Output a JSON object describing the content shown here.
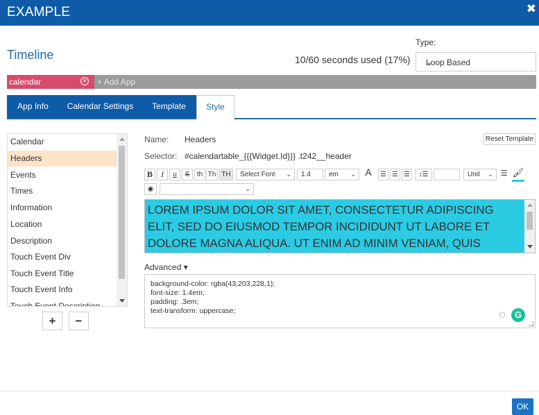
{
  "window": {
    "title": "EXAMPLE",
    "close_glyph": "✖"
  },
  "header": {
    "title": "Timeline",
    "usage": "10/60 seconds used (17%)"
  },
  "type": {
    "label": "Type:",
    "value": "Loop Based"
  },
  "apps": {
    "tag": "calendar",
    "add_placeholder": "+ Add App"
  },
  "tabs": [
    {
      "label": "App Info"
    },
    {
      "label": "Calendar Settings"
    },
    {
      "label": "Template"
    },
    {
      "label": "Style",
      "active": true
    }
  ],
  "style_list": {
    "items": [
      "Calendar",
      "Headers",
      "Events",
      "Times",
      "Information",
      "Location",
      "Description",
      "Touch Event Div",
      "Touch Event Title",
      "Touch Event Info",
      "Touch Event Description"
    ],
    "selected": "Headers",
    "add_label": "+",
    "remove_label": "−"
  },
  "editor": {
    "name_label": "Name:",
    "name_value": "Headers",
    "selector_label": "Selector:",
    "selector_value": "#calendartable_{{{Widget.Id}}} .t242__header",
    "reset_label": "Reset Template",
    "toolbar": {
      "bold": "B",
      "italic": "I",
      "underline": "u",
      "strike": "S",
      "th_lower": "th",
      "th_title": "Th",
      "th_upper": "TH",
      "font_select": "Select Font",
      "size_value": "1.4",
      "size_unit": "em",
      "font_color": "A",
      "line_height_unit": "Unit"
    },
    "preview_text": "Lorem ipsum dolor sit amet, consectetur adipiscing elit, sed do eiusmod tempor incididunt ut labore et dolore magna aliqua. Ut enim ad minim veniam, quis",
    "advanced_label": "Advanced ▾",
    "css_lines": [
      "background-color: rgba(43,203,228,1);",
      "font-size: 1.4em;",
      "padding: .3em;",
      "text-transform: uppercase;"
    ]
  },
  "footer": {
    "ok_label": "OK"
  },
  "colors": {
    "brand": "#0e5ca8",
    "tag": "#d84a6b",
    "preview_bg": "#2bcbe4",
    "selected_row": "#fde3c8"
  }
}
